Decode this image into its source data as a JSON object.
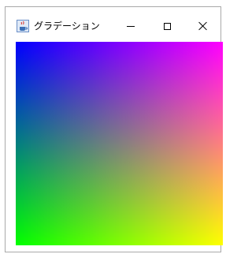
{
  "window": {
    "title": "グラデーション",
    "app_icon": "java-cup-icon"
  },
  "controls": {
    "minimize": "minimize-icon",
    "maximize": "maximize-icon",
    "close": "close-icon"
  },
  "gradient": {
    "top_left": "#0000ff",
    "top_right": "#ff00ff",
    "bottom_left": "#00ff00",
    "bottom_right": "#ffff00"
  }
}
